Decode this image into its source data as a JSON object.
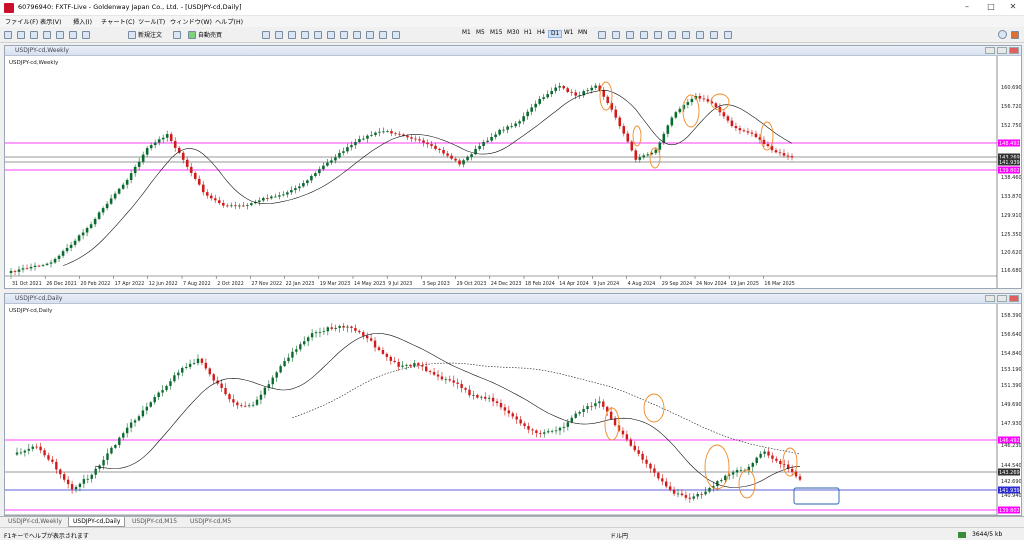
{
  "window": {
    "title": "607969​40: FXTF-Live - Goldenway Japan Co., Ltd. - [USDJPY-cd,Daily]"
  },
  "menu": [
    "ファイル(F)",
    "表示(V)",
    "挿入(I)",
    "チャート(C)",
    "ツール(T)",
    "ウィンドウ(W)",
    "ヘルプ(H)"
  ],
  "toolbar": {
    "new_order": "新規注文",
    "auto_trade": "自動売買",
    "timeframes": [
      "M1",
      "M5",
      "M15",
      "M30",
      "H1",
      "H4",
      "D1",
      "W1",
      "MN"
    ],
    "active_timeframe": "D1"
  },
  "weekly": {
    "title": "USDJPY-cd,Weekly",
    "symbol_label": "USDJPY-cd,Weekly",
    "prices": [
      "160.690",
      "156.720",
      "152.750",
      "148.492",
      "143.269",
      "141.939",
      "139.802",
      "138.460",
      "133.870",
      "129.910",
      "125.350",
      "120.620",
      "116.680"
    ],
    "dates": [
      "31 Oct 2021",
      "26 Dec 2021",
      "20 Feb 2022",
      "17 Apr 2022",
      "12 Jun 2022",
      "7 Aug 2022",
      "2 Oct 2022",
      "27 Nov 2022",
      "22 Jan 2023",
      "19 Mar 2023",
      "14 May 2023",
      "9 Jul 2023",
      "3 Sep 2023",
      "29 Oct 2023",
      "24 Dec 2023",
      "18 Feb 2024",
      "14 Apr 2024",
      "9 Jun 2024",
      "4 Aug 2024",
      "29 Sep 2024",
      "24 Nov 2024",
      "19 Jan 2025",
      "16 Mar 2025"
    ]
  },
  "daily": {
    "title": "USDJPY-cd,Daily",
    "symbol_label": "USDJPY-cd,Daily",
    "prices": [
      "158.390",
      "156.640",
      "154.840",
      "153.190",
      "151.390",
      "149.690",
      "147.930",
      "146.492",
      "146.230",
      "144.540",
      "143.269",
      "142.690",
      "140.940",
      "141.939",
      "139.802"
    ]
  },
  "tabs": [
    "USDJPY-cd,Weekly",
    "USDJPY-cd,Daily",
    "USDJPY-cd,M15",
    "USDJPY-cd,M5"
  ],
  "active_tab": "USDJPY-cd,Daily",
  "status": {
    "help": "F1キーでヘルプが表示されます",
    "center": "ドル円",
    "traffic": "3644/5 kb"
  },
  "colors": {
    "bull": "#0b6b2e",
    "bear": "#d11a1a",
    "level_line": "#ff00ff",
    "ma": "#111111",
    "highlight_circle": "#f08a24"
  }
}
